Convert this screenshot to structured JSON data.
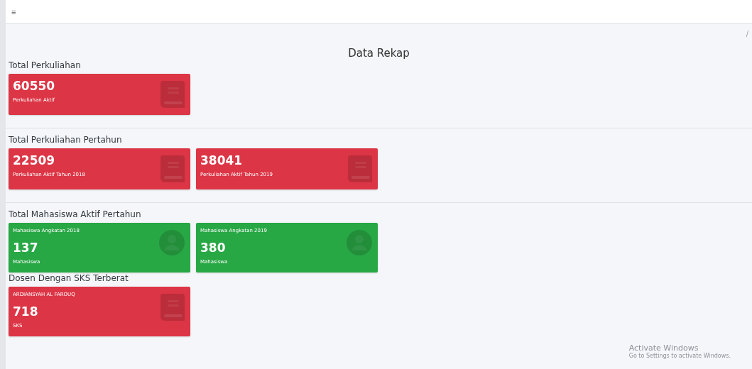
{
  "topbar": {
    "menu_glyph": "≡"
  },
  "breadcrumb": "/",
  "page_title": "Data Rekap",
  "sections": [
    {
      "heading": "Total Perkuliahan",
      "divider": true,
      "cards": [
        {
          "kind": "total",
          "color": "#dc3545",
          "value": "60550",
          "label": "Perkuliahan Aktif"
        }
      ]
    },
    {
      "heading": "Total Perkuliahan Pertahun",
      "divider": true,
      "cards": [
        {
          "kind": "total",
          "color": "#dc3545",
          "value": "22509",
          "label": "Perkuliahan Aktif Tahun 2018"
        },
        {
          "kind": "total",
          "color": "#dc3545",
          "value": "38041",
          "label": "Perkuliahan Aktif Tahun 2019"
        }
      ]
    },
    {
      "heading": "Total Mahasiswa Aktif Pertahun",
      "divider": false,
      "cards": [
        {
          "kind": "student",
          "color": "#28a745",
          "caption": "Mahasiswa Angkatan 2018",
          "value": "137",
          "label": "Mahasiswa"
        },
        {
          "kind": "student",
          "color": "#28a745",
          "caption": "Mahasiswa Angkatan 2019",
          "value": "380",
          "label": "Mahasiswa"
        }
      ]
    },
    {
      "heading": "Dosen Dengan SKS Terberat",
      "divider": false,
      "cards": [
        {
          "kind": "lecturer",
          "color": "#dc3545",
          "caption": "ARDIANSYAH AL FAROUQ",
          "value": "718",
          "label": "SKS"
        }
      ]
    }
  ],
  "os_notice": {
    "title": "Activate Windows",
    "message": "Go to Settings to activate Windows."
  }
}
